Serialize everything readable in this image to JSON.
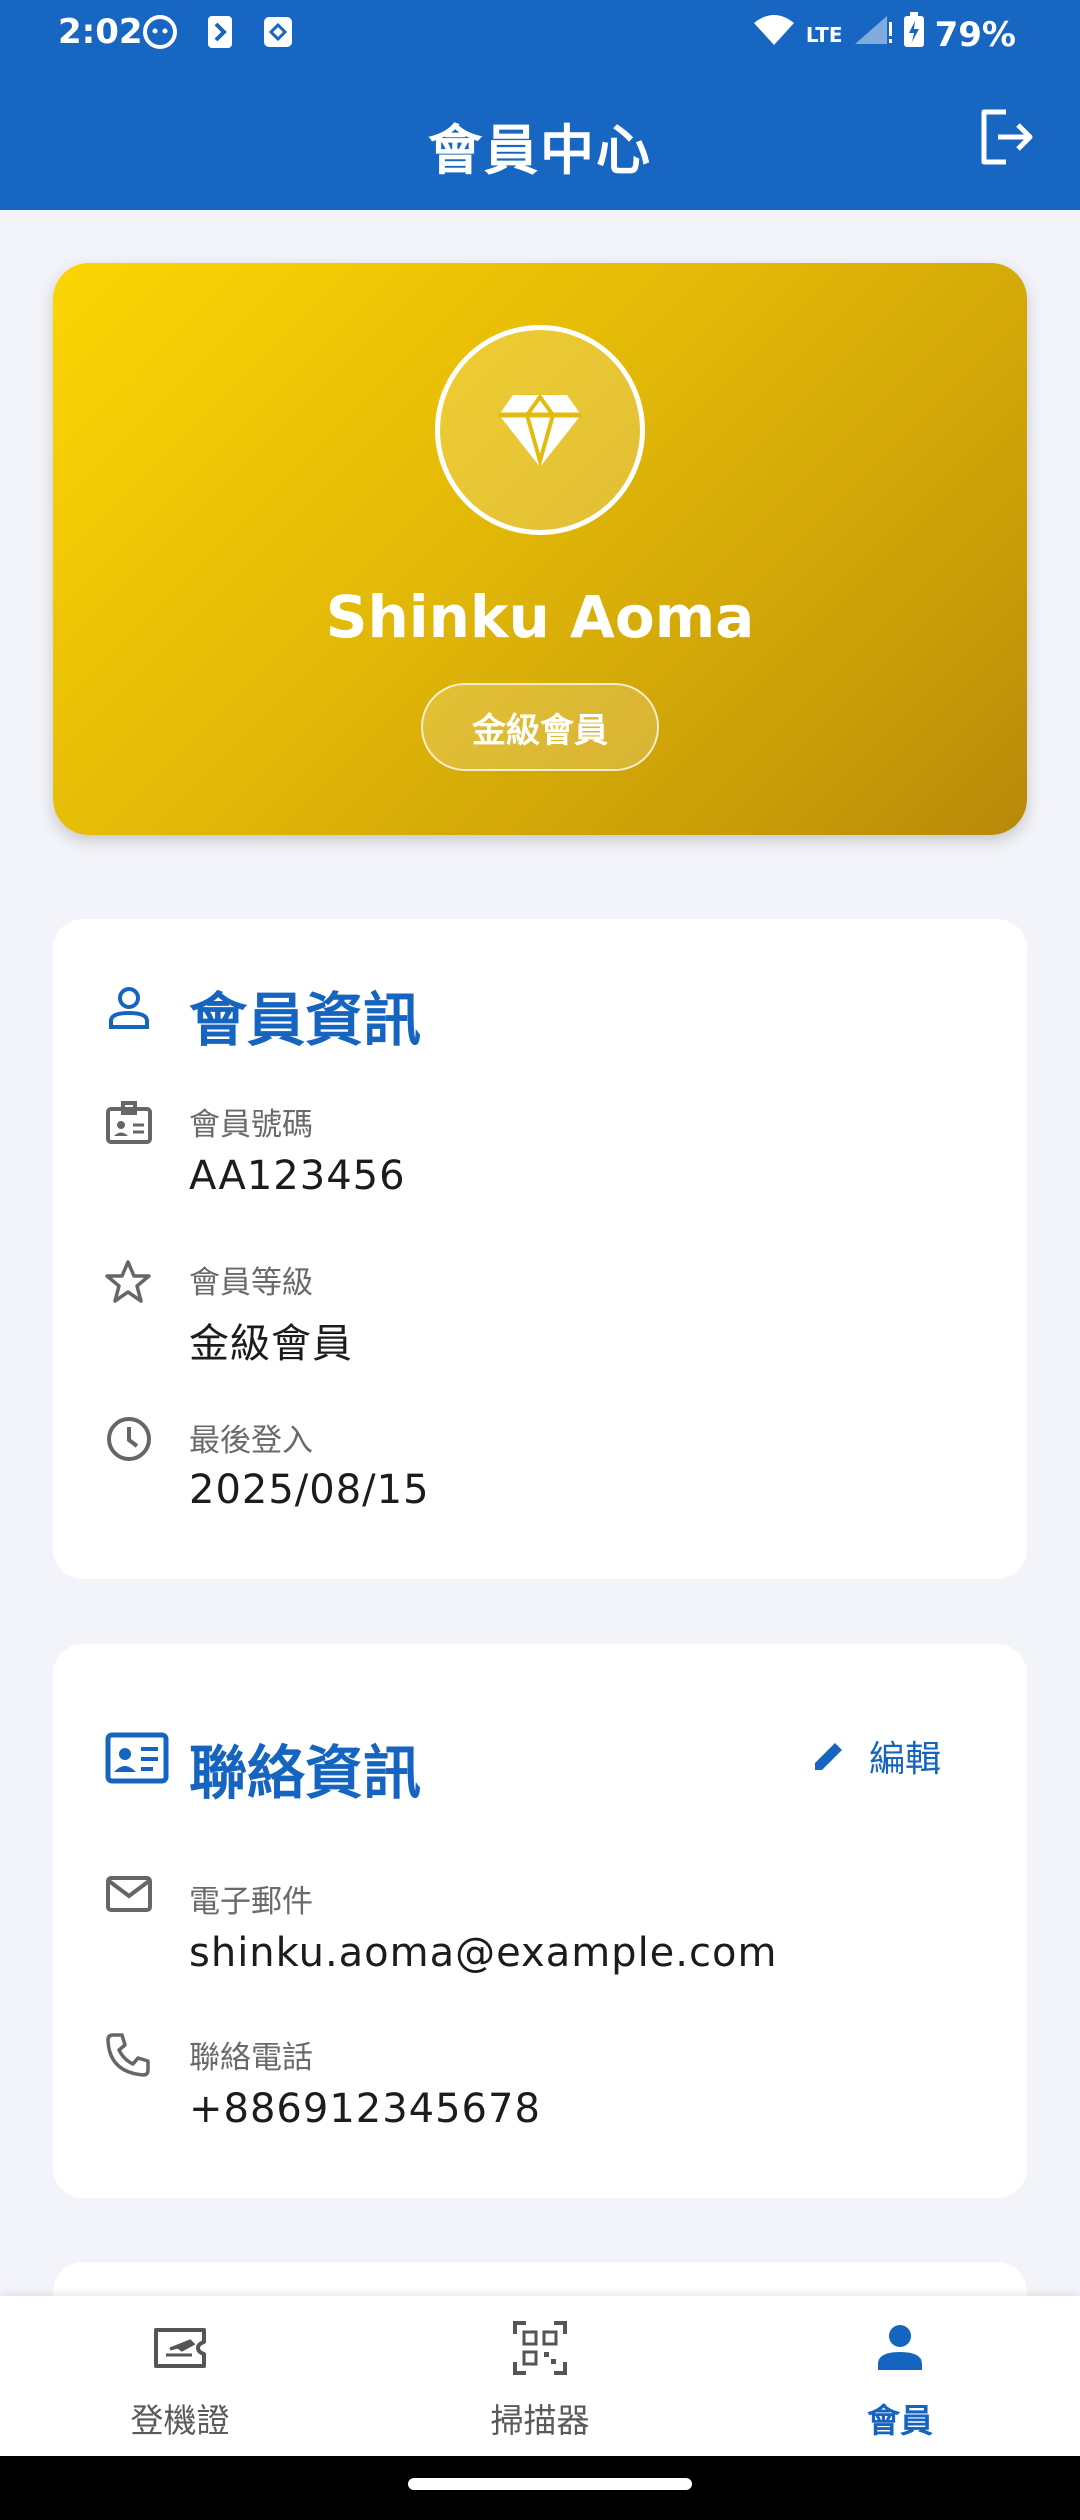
{
  "status_bar": {
    "time": "2:02",
    "battery": "79%",
    "network": "LTE"
  },
  "app_bar": {
    "title": "會員中心",
    "logout_icon": "logout-icon"
  },
  "member_card": {
    "name": "Shinku Aoma",
    "tier_badge": "金級會員",
    "icon": "diamond-icon",
    "gradient_colors": [
      "#fcd603",
      "#b8890a"
    ]
  },
  "member_info": {
    "title": "會員資訊",
    "rows": [
      {
        "icon": "id-card-icon",
        "label": "會員號碼",
        "value": "AA123456"
      },
      {
        "icon": "star-icon",
        "label": "會員等級",
        "value": "金級會員"
      },
      {
        "icon": "clock-icon",
        "label": "最後登入",
        "value": "2025/08/15"
      }
    ]
  },
  "contact_info": {
    "title": "聯絡資訊",
    "edit_label": "編輯",
    "rows": [
      {
        "icon": "mail-icon",
        "label": "電子郵件",
        "value": "shinku.aoma@example.com"
      },
      {
        "icon": "phone-icon",
        "label": "聯絡電話",
        "value": "+886912345678"
      }
    ]
  },
  "bottom_nav": {
    "items": [
      {
        "label": "登機證",
        "icon": "boarding-pass-icon",
        "active": false
      },
      {
        "label": "掃描器",
        "icon": "qr-scanner-icon",
        "active": false
      },
      {
        "label": "會員",
        "icon": "person-icon",
        "active": true
      }
    ]
  },
  "colors": {
    "primary": "#1766c2",
    "accent_text": "#1565c0",
    "background": "#f3f4f9"
  }
}
